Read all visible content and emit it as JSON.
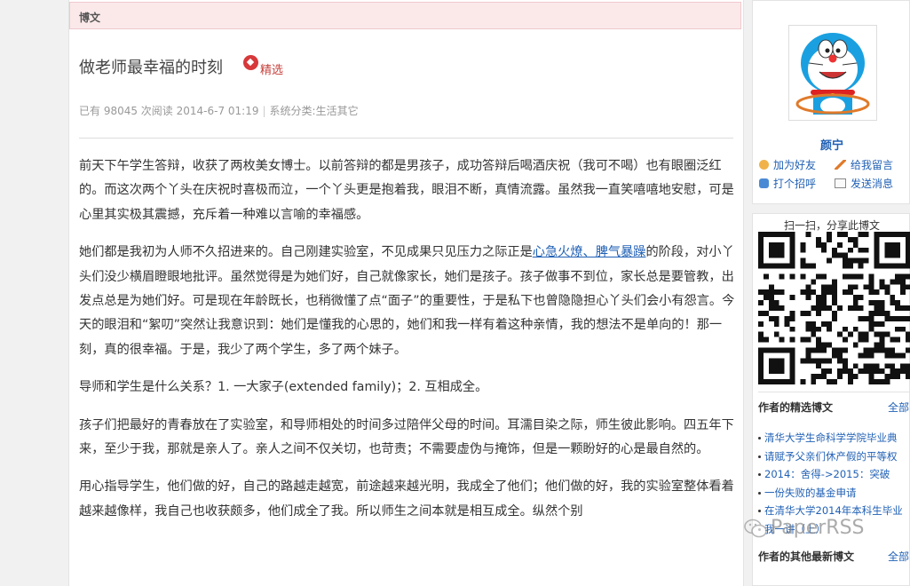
{
  "tab_label": "博文",
  "article": {
    "title": "做老师最幸福的时刻",
    "badge": "精选",
    "meta_reads": "已有 98045 次阅读 2014-6-7 01:19",
    "meta_sep": "|",
    "meta_category": "系统分类:生活其它",
    "p1": "前天下午学生答辩，收获了两枚美女博士。以前答辩的都是男孩子，成功答辩后喝酒庆祝（我可不喝）也有眼圈泛红的。而这次两个丫头在庆祝时喜极而泣，一个丫头更是抱着我，眼泪不断，真情流露。虽然我一直笑嘻嘻地安慰，可是心里其实极其震撼，充斥着一种难以言喻的幸福感。",
    "p2_a": "她们都是我初为人师不久招进来的。自己刚建实验室，不见成果只见压力之际正是",
    "p2_link": "心急火燎、脾气暴躁",
    "p2_b": "的阶段，对小丫头们没少横眉瞪眼地批评。虽然觉得是为她们好，自己就像家长，她们是孩子。孩子做事不到位，家长总是要管教，出发点总是为她们好。可是现在年龄既长，也稍微懂了点“面子”的重要性，于是私下也曾隐隐担心丫头们会小有怨言。今天的眼泪和“絮叨”突然让我意识到：她们是懂我的心思的，她们和我一样有着这种亲情，我的想法不是单向的！那一刻，真的很幸福。于是，我少了两个学生，多了两个妹子。",
    "p3": "导师和学生是什么关系？1. 一大家子(extended family)；2. 互相成全。",
    "p4": "孩子们把最好的青春放在了实验室，和导师相处的时间多过陪伴父母的时间。耳濡目染之际，师生彼此影响。四五年下来，至少于我，那就是亲人了。亲人之间不仅关切，也苛责；不需要虚伪与掩饰，但是一颗盼好的心是最自然的。",
    "p5": "用心指导学生，他们做的好，自己的路越走越宽，前途越来越光明，我成全了他们；他们做的好，我的实验室整体看着越来越像样，我自己也收获颇多，他们成全了我。所以师生之间本就是相互成全。纵然个别"
  },
  "profile": {
    "name": "颜宁",
    "add_friend": "加为好友",
    "leave_message": "给我留言",
    "greet": "打个招呼",
    "send_message": "发送消息"
  },
  "share": {
    "scan_label": "扫一扫，分享此博文"
  },
  "featured": {
    "heading": "作者的精选博文",
    "more": "全部",
    "items": [
      "清华大学生命科学学院毕业典",
      "请赋予父亲们休产假的平等权",
      "2014：舍得->2015：突破",
      "一份失败的基金申请",
      "在清华大学2014年本科生毕业",
      "我一讲（上）"
    ]
  },
  "latest": {
    "heading": "作者的其他最新博文",
    "more": "全部"
  },
  "watermark": "PaperRSS",
  "colors": {
    "link": "#2161b5",
    "tab_bg": "#fbe9ea",
    "badge_red": "#c6413c"
  }
}
